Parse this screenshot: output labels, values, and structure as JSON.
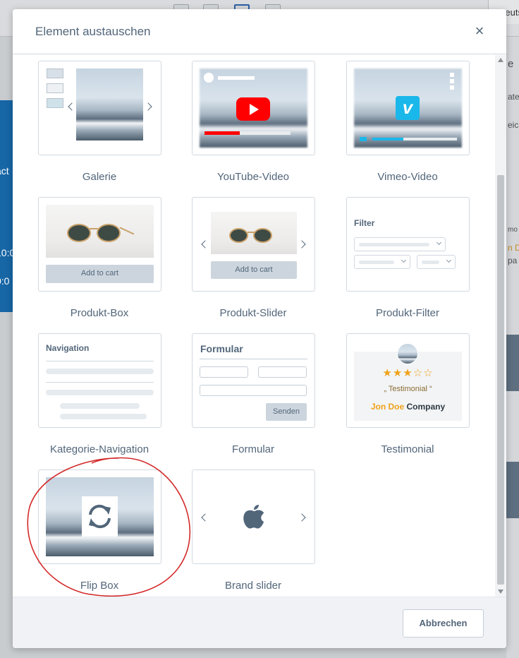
{
  "background": {
    "lang_label": "Deutsch",
    "left_texts": [
      "act",
      "10:0",
      "0:0"
    ],
    "right_texts": [
      "e",
      "ateg",
      "eich",
      "mo",
      "n D",
      "pa"
    ]
  },
  "modal": {
    "title": "Element austauschen",
    "close_label": "×",
    "cancel_label": "Abbrechen"
  },
  "tiles": [
    {
      "label": "Galerie"
    },
    {
      "label": "YouTube-Video"
    },
    {
      "label": "Vimeo-Video"
    },
    {
      "label": "Produkt-Box",
      "cart_label": "Add to cart"
    },
    {
      "label": "Produkt-Slider",
      "cart_label": "Add to cart"
    },
    {
      "label": "Produkt-Filter",
      "heading": "Filter"
    },
    {
      "label": "Kategorie-Navigation",
      "heading": "Navigation"
    },
    {
      "label": "Formular",
      "heading": "Formular",
      "submit_label": "Senden"
    },
    {
      "label": "Testimonial",
      "stars_filled": 3,
      "stars_total": 5,
      "quote": "„ Testimonial “",
      "author": "Jon Doe",
      "company": "Company"
    },
    {
      "label": "Flip Box"
    },
    {
      "label": "Brand slider"
    }
  ],
  "colors": {
    "youtube_red": "#ff0000",
    "vimeo_blue": "#1ab7ea",
    "star_gold": "#f0a21a",
    "text_slate": "#52667a",
    "annotation_red": "#d42a2a"
  },
  "icons": {
    "close": "x-icon",
    "flip": "refresh-icon",
    "brand": "apple-logo-icon",
    "youtube": "youtube-play-icon",
    "vimeo": "vimeo-logo-icon"
  }
}
